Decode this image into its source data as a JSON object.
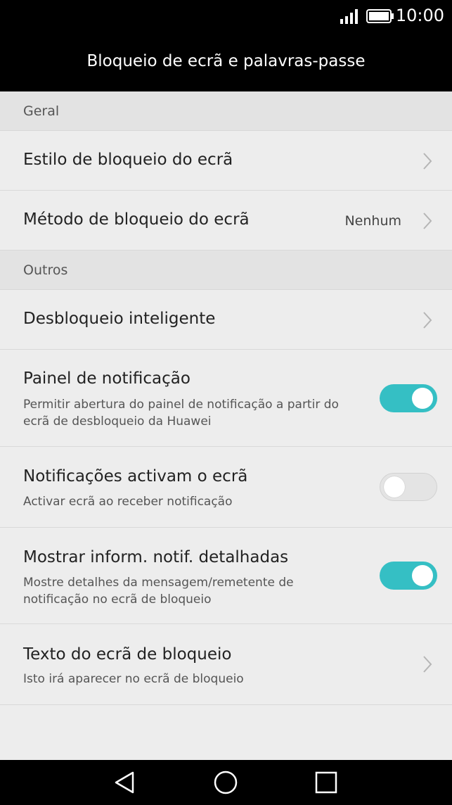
{
  "status_bar": {
    "time": "10:00",
    "icons": [
      "signal-icon",
      "battery-icon"
    ]
  },
  "app_bar": {
    "title": "Bloqueio de ecrã e palavras-passe"
  },
  "sections": [
    {
      "header": "Geral",
      "items": [
        {
          "title": "Estilo de bloqueio do ecrã",
          "type": "nav"
        },
        {
          "title": "Método de bloqueio do ecrã",
          "value": "Nenhum",
          "type": "nav"
        }
      ]
    },
    {
      "header": "Outros",
      "items": [
        {
          "title": "Desbloqueio inteligente",
          "type": "nav"
        },
        {
          "title": "Painel de notificação",
          "subtitle": "Permitir abertura do painel de notificação a partir do ecrã de desbloqueio da Huawei",
          "type": "toggle",
          "state": "on"
        },
        {
          "title": "Notificações activam o ecrã",
          "subtitle": "Activar ecrã ao receber notificação",
          "type": "toggle",
          "state": "off"
        },
        {
          "title": "Mostrar inform. notif. detalhadas",
          "subtitle": "Mostre detalhes da mensagem/remetente de notificação no ecrã de bloqueio",
          "type": "toggle",
          "state": "on"
        },
        {
          "title": "Texto do ecrã de bloqueio",
          "subtitle": "Isto irá aparecer no ecrã de bloqueio",
          "type": "nav"
        }
      ]
    }
  ],
  "nav_bar": {
    "buttons": [
      "back-icon",
      "home-icon",
      "recents-icon"
    ]
  },
  "colors": {
    "accent": "#35bfc4",
    "background": "#ededed",
    "section_header": "#e3e3e3"
  }
}
